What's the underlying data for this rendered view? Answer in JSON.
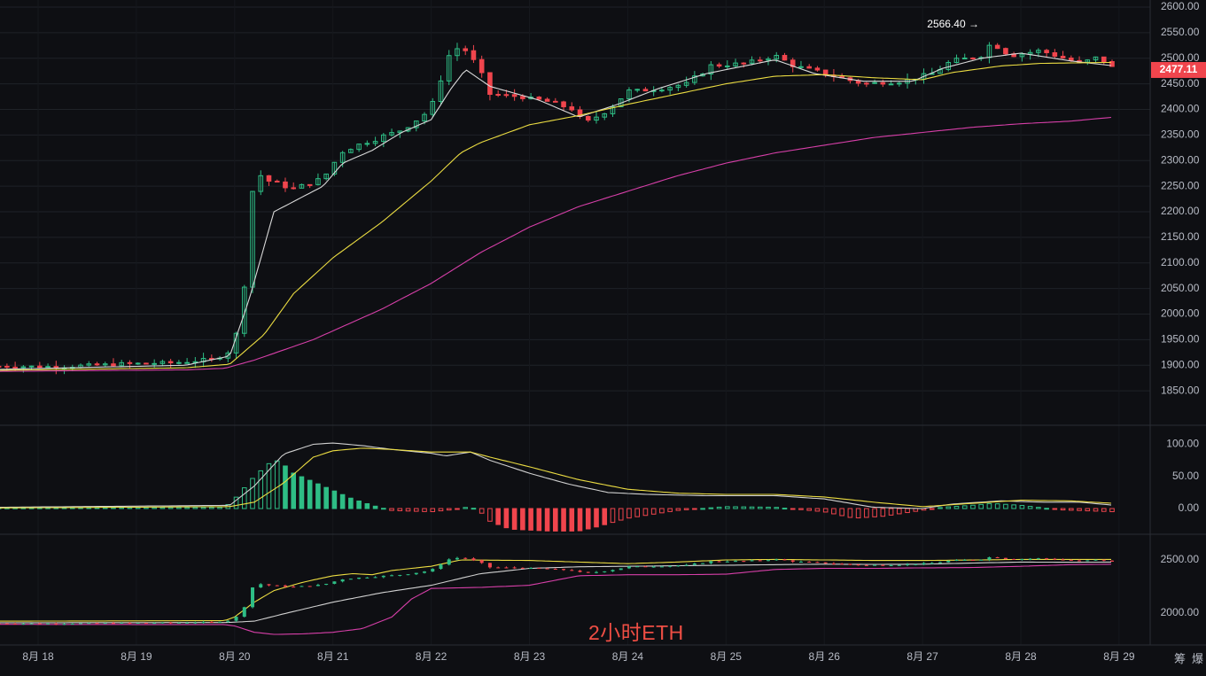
{
  "chart_data": [
    {
      "type": "candlestick",
      "panel": "main",
      "ylim": [
        1800,
        2600
      ],
      "y_ticks": [
        "2600.00",
        "2550.00",
        "2500.00",
        "2450.00",
        "2400.00",
        "2350.00",
        "2300.00",
        "2250.00",
        "2200.00",
        "2150.00",
        "2100.00",
        "2050.00",
        "2000.00",
        "1950.00",
        "1900.00",
        "1850.00"
      ],
      "categories": [
        "8月 18",
        "8月 19",
        "8月 20",
        "8月 21",
        "8月 22",
        "8月 23",
        "8月 24",
        "8月 25",
        "8月 26",
        "8月 27",
        "8月 28",
        "8月 29"
      ],
      "high_annotation": "2566.40 →",
      "current_price": "2477.11",
      "price_anchors": [
        [
          17.6,
          1898
        ],
        [
          18.2,
          1897
        ],
        [
          18.8,
          1902
        ],
        [
          19.4,
          1905
        ],
        [
          19.8,
          1912
        ],
        [
          20.0,
          1935
        ],
        [
          20.1,
          2080
        ],
        [
          20.2,
          2280
        ],
        [
          20.35,
          2260
        ],
        [
          20.6,
          2245
        ],
        [
          20.9,
          2265
        ],
        [
          21.1,
          2320
        ],
        [
          21.4,
          2340
        ],
        [
          21.7,
          2360
        ],
        [
          22.0,
          2400
        ],
        [
          22.15,
          2500
        ],
        [
          22.3,
          2525
        ],
        [
          22.4,
          2505
        ],
        [
          22.6,
          2430
        ],
        [
          22.9,
          2425
        ],
        [
          23.2,
          2415
        ],
        [
          23.45,
          2400
        ],
        [
          23.55,
          2370
        ],
        [
          23.8,
          2400
        ],
        [
          24.0,
          2435
        ],
        [
          24.3,
          2440
        ],
        [
          24.6,
          2450
        ],
        [
          24.85,
          2485
        ],
        [
          25.2,
          2490
        ],
        [
          25.5,
          2505
        ],
        [
          25.7,
          2485
        ],
        [
          26.0,
          2470
        ],
        [
          26.4,
          2450
        ],
        [
          26.8,
          2455
        ],
        [
          27.1,
          2470
        ],
        [
          27.3,
          2495
        ],
        [
          27.6,
          2505
        ],
        [
          27.7,
          2530
        ],
        [
          27.9,
          2505
        ],
        [
          28.2,
          2515
        ],
        [
          28.6,
          2490
        ],
        [
          28.8,
          2503
        ],
        [
          28.95,
          2478
        ]
      ],
      "ma_lines": [
        {
          "color": "#d9d9d9",
          "anchors": [
            [
              17.6,
              1892
            ],
            [
              19.5,
              1900
            ],
            [
              19.95,
              1918
            ],
            [
              20.15,
              2030
            ],
            [
              20.4,
              2200
            ],
            [
              20.9,
              2250
            ],
            [
              21.1,
              2295
            ],
            [
              21.4,
              2320
            ],
            [
              21.7,
              2355
            ],
            [
              22.0,
              2380
            ],
            [
              22.2,
              2440
            ],
            [
              22.35,
              2478
            ],
            [
              22.6,
              2445
            ],
            [
              23.1,
              2418
            ],
            [
              23.5,
              2385
            ],
            [
              23.9,
              2410
            ],
            [
              24.3,
              2440
            ],
            [
              24.8,
              2470
            ],
            [
              25.5,
              2497
            ],
            [
              25.9,
              2470
            ],
            [
              26.4,
              2455
            ],
            [
              26.9,
              2455
            ],
            [
              27.2,
              2480
            ],
            [
              27.6,
              2500
            ],
            [
              28.0,
              2510
            ],
            [
              28.5,
              2495
            ],
            [
              28.95,
              2485
            ]
          ]
        },
        {
          "color": "#ebdc42",
          "anchors": [
            [
              17.6,
              1890
            ],
            [
              19.5,
              1895
            ],
            [
              19.95,
              1902
            ],
            [
              20.3,
              1960
            ],
            [
              20.6,
              2040
            ],
            [
              21.0,
              2110
            ],
            [
              21.5,
              2180
            ],
            [
              22.0,
              2260
            ],
            [
              22.3,
              2315
            ],
            [
              22.5,
              2335
            ],
            [
              23.0,
              2370
            ],
            [
              23.5,
              2388
            ],
            [
              24.0,
              2410
            ],
            [
              24.5,
              2430
            ],
            [
              25.0,
              2450
            ],
            [
              25.5,
              2465
            ],
            [
              26.0,
              2468
            ],
            [
              26.5,
              2462
            ],
            [
              27.0,
              2458
            ],
            [
              27.3,
              2472
            ],
            [
              27.8,
              2485
            ],
            [
              28.2,
              2490
            ],
            [
              28.95,
              2492
            ]
          ]
        },
        {
          "color": "#d63fa8",
          "anchors": [
            [
              17.6,
              1888
            ],
            [
              19.5,
              1891
            ],
            [
              19.9,
              1894
            ],
            [
              20.2,
              1910
            ],
            [
              20.8,
              1950
            ],
            [
              21.5,
              2010
            ],
            [
              22.0,
              2060
            ],
            [
              22.5,
              2120
            ],
            [
              23.0,
              2170
            ],
            [
              23.5,
              2210
            ],
            [
              24.0,
              2240
            ],
            [
              24.5,
              2270
            ],
            [
              25.0,
              2295
            ],
            [
              25.5,
              2315
            ],
            [
              26.0,
              2330
            ],
            [
              26.5,
              2345
            ],
            [
              27.0,
              2355
            ],
            [
              27.5,
              2365
            ],
            [
              28.0,
              2372
            ],
            [
              28.5,
              2377
            ],
            [
              28.95,
              2385
            ]
          ]
        }
      ]
    },
    {
      "type": "macd",
      "panel": "indicator",
      "ylim": [
        -40,
        120
      ],
      "y_ticks": [
        "100.00",
        "50.00",
        "0.00"
      ],
      "hist_anchors": [
        [
          17.6,
          1
        ],
        [
          19.9,
          2
        ],
        [
          20.0,
          15
        ],
        [
          20.2,
          50
        ],
        [
          20.35,
          70
        ],
        [
          20.45,
          75
        ],
        [
          20.6,
          55
        ],
        [
          20.9,
          35
        ],
        [
          21.2,
          15
        ],
        [
          21.4,
          5
        ],
        [
          21.6,
          -3
        ],
        [
          22.0,
          -5
        ],
        [
          22.2,
          -2
        ],
        [
          22.4,
          3
        ],
        [
          22.5,
          -5
        ],
        [
          22.6,
          -20
        ],
        [
          22.8,
          -32
        ],
        [
          23.2,
          -35
        ],
        [
          23.5,
          -35
        ],
        [
          23.65,
          -30
        ],
        [
          24.0,
          -15
        ],
        [
          24.5,
          -3
        ],
        [
          25.0,
          3
        ],
        [
          25.5,
          2
        ],
        [
          26.0,
          -5
        ],
        [
          26.3,
          -15
        ],
        [
          26.6,
          -12
        ],
        [
          26.9,
          -5
        ],
        [
          27.2,
          2
        ],
        [
          27.5,
          5
        ],
        [
          27.7,
          8
        ],
        [
          28.0,
          5
        ],
        [
          28.4,
          -2
        ],
        [
          28.95,
          -5
        ]
      ],
      "lines": [
        {
          "color": "#d0d0d0",
          "anchors": [
            [
              17.6,
              2
            ],
            [
              19.95,
              5
            ],
            [
              20.2,
              35
            ],
            [
              20.5,
              85
            ],
            [
              20.8,
              100
            ],
            [
              21.0,
              102
            ],
            [
              21.3,
              98
            ],
            [
              21.6,
              92
            ],
            [
              22.0,
              86
            ],
            [
              22.15,
              82
            ],
            [
              22.4,
              88
            ],
            [
              22.6,
              75
            ],
            [
              23.0,
              55
            ],
            [
              23.4,
              38
            ],
            [
              23.8,
              25
            ],
            [
              24.2,
              22
            ],
            [
              24.8,
              20
            ],
            [
              25.5,
              20
            ],
            [
              26.0,
              15
            ],
            [
              26.5,
              2
            ],
            [
              27.0,
              0
            ],
            [
              27.3,
              7
            ],
            [
              27.8,
              12
            ],
            [
              28.2,
              10
            ],
            [
              28.6,
              10
            ],
            [
              28.95,
              5
            ]
          ]
        },
        {
          "color": "#ebdc42",
          "anchors": [
            [
              17.6,
              1
            ],
            [
              19.95,
              3
            ],
            [
              20.2,
              10
            ],
            [
              20.5,
              40
            ],
            [
              20.8,
              80
            ],
            [
              21.0,
              90
            ],
            [
              21.3,
              94
            ],
            [
              21.6,
              92
            ],
            [
              22.0,
              88
            ],
            [
              22.4,
              88
            ],
            [
              22.6,
              80
            ],
            [
              23.0,
              65
            ],
            [
              23.5,
              45
            ],
            [
              24.0,
              30
            ],
            [
              24.5,
              24
            ],
            [
              25.0,
              22
            ],
            [
              25.5,
              22
            ],
            [
              26.0,
              18
            ],
            [
              26.5,
              10
            ],
            [
              27.0,
              3
            ],
            [
              27.5,
              8
            ],
            [
              28.0,
              13
            ],
            [
              28.5,
              12
            ],
            [
              28.95,
              8
            ]
          ]
        }
      ]
    },
    {
      "type": "bollinger",
      "panel": "bands",
      "ylim": [
        1860,
        2600
      ],
      "y_ticks": [
        "2500.00",
        "2000.00"
      ],
      "lines": [
        {
          "color": "#ebdc42",
          "anchors": [
            [
              17.6,
              1920
            ],
            [
              19.9,
              1925
            ],
            [
              20.0,
              1960
            ],
            [
              20.2,
              2100
            ],
            [
              20.4,
              2210
            ],
            [
              20.7,
              2290
            ],
            [
              21.0,
              2350
            ],
            [
              21.2,
              2370
            ],
            [
              21.4,
              2360
            ],
            [
              21.6,
              2400
            ],
            [
              22.0,
              2440
            ],
            [
              22.3,
              2500
            ],
            [
              23.0,
              2495
            ],
            [
              23.5,
              2480
            ],
            [
              24.0,
              2465
            ],
            [
              24.5,
              2480
            ],
            [
              25.0,
              2500
            ],
            [
              25.5,
              2505
            ],
            [
              26.0,
              2500
            ],
            [
              26.5,
              2495
            ],
            [
              27.0,
              2495
            ],
            [
              27.6,
              2500
            ],
            [
              28.0,
              2505
            ],
            [
              28.5,
              2505
            ],
            [
              28.95,
              2505
            ]
          ]
        },
        {
          "color": "#d0d0d0",
          "anchors": [
            [
              17.6,
              1905
            ],
            [
              19.9,
              1907
            ],
            [
              20.2,
              1920
            ],
            [
              20.5,
              1990
            ],
            [
              21.0,
              2100
            ],
            [
              21.5,
              2190
            ],
            [
              22.0,
              2260
            ],
            [
              22.5,
              2370
            ],
            [
              23.0,
              2420
            ],
            [
              23.5,
              2435
            ],
            [
              24.0,
              2440
            ],
            [
              24.5,
              2445
            ],
            [
              25.0,
              2450
            ],
            [
              25.5,
              2455
            ],
            [
              26.0,
              2460
            ],
            [
              26.5,
              2458
            ],
            [
              27.0,
              2460
            ],
            [
              27.5,
              2470
            ],
            [
              28.0,
              2480
            ],
            [
              28.5,
              2478
            ],
            [
              28.95,
              2480
            ]
          ]
        },
        {
          "color": "#d63fa8",
          "anchors": [
            [
              17.6,
              1890
            ],
            [
              19.9,
              1888
            ],
            [
              20.0,
              1875
            ],
            [
              20.2,
              1815
            ],
            [
              20.4,
              1795
            ],
            [
              20.7,
              1800
            ],
            [
              21.0,
              1815
            ],
            [
              21.3,
              1850
            ],
            [
              21.6,
              1960
            ],
            [
              21.8,
              2130
            ],
            [
              22.0,
              2230
            ],
            [
              22.5,
              2240
            ],
            [
              23.0,
              2260
            ],
            [
              23.5,
              2350
            ],
            [
              24.0,
              2360
            ],
            [
              24.5,
              2360
            ],
            [
              25.0,
              2365
            ],
            [
              25.5,
              2410
            ],
            [
              26.0,
              2420
            ],
            [
              26.5,
              2420
            ],
            [
              27.0,
              2425
            ],
            [
              27.5,
              2428
            ],
            [
              28.0,
              2440
            ],
            [
              28.5,
              2455
            ],
            [
              28.95,
              2460
            ]
          ]
        }
      ]
    }
  ],
  "watermark": "2小时ETH",
  "corner_labels": [
    "筹",
    "爆"
  ],
  "colors": {
    "up": "#2ebd85",
    "down": "#f0454d",
    "bg": "#0e0f13",
    "grid": "#1f2228",
    "price_tag": "#f0454d"
  }
}
